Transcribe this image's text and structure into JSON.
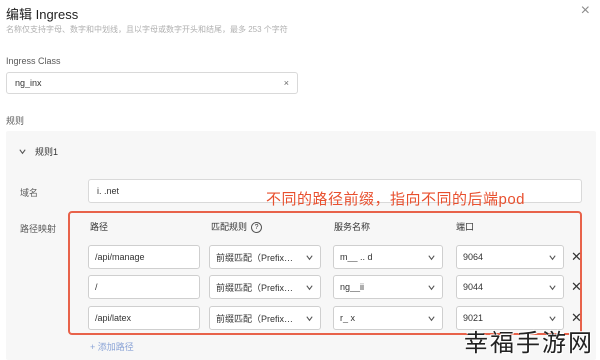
{
  "dialog": {
    "title": "编辑 Ingress",
    "close_icon": "×"
  },
  "hint": "名称仅支持字母、数字和中划线，且以字母或数字开头和结尾，最多 253 个字符",
  "ingress_class": {
    "label": "Ingress Class",
    "value": "ng_inx",
    "clear": "×"
  },
  "rules": {
    "section_label": "规则",
    "rule_title": "规则1",
    "domain_label": "域名",
    "domain_value": "i.  .net",
    "path_mapping_label": "路径映射",
    "columns": {
      "path": "路径",
      "match_rule": "匹配规则",
      "service": "服务名称",
      "port": "端口"
    },
    "rows": [
      {
        "path": "/api/manage",
        "match": "前缀匹配（Prefix…",
        "service": "m__ .. d",
        "port": "9064"
      },
      {
        "path": "/",
        "match": "前缀匹配（Prefix…",
        "service": "ng__ii",
        "port": "9044"
      },
      {
        "path": "/api/latex",
        "match": "前缀匹配（Prefix…",
        "service": "r_ x",
        "port": "9021"
      }
    ],
    "add_path": "+ 添加路径"
  },
  "annotation": "不同的路径前缀，指向不同的后端pod",
  "watermark": "幸福手游网",
  "colors": {
    "accent_red": "#e8624a",
    "link_blue": "#8aa3d6"
  }
}
